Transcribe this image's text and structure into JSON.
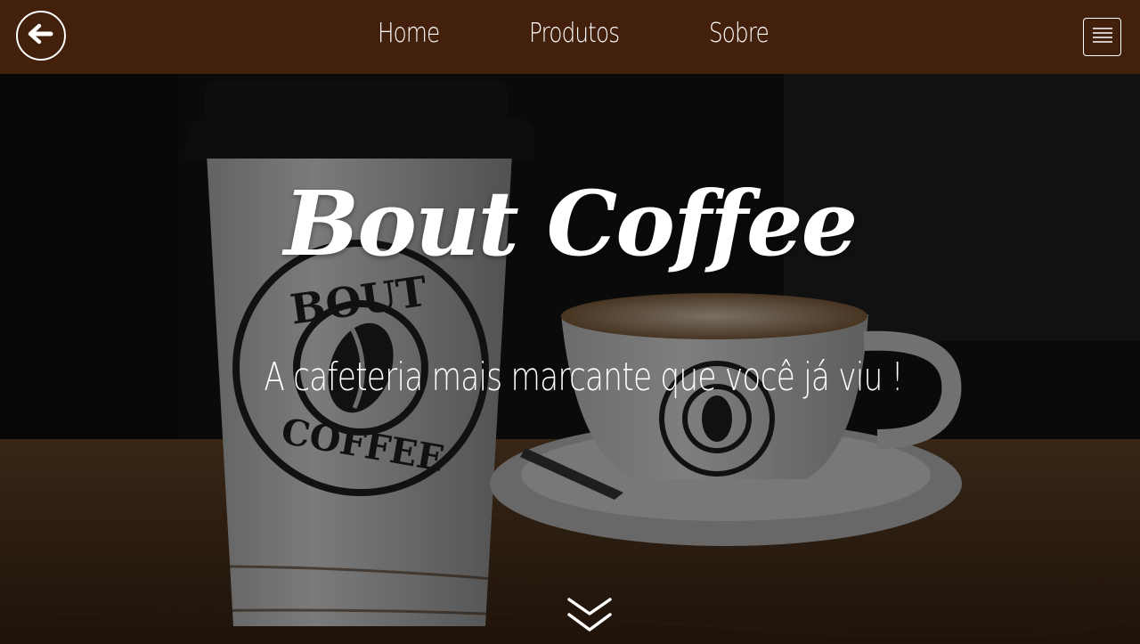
{
  "navbar": {
    "background_color": "#43200c",
    "back_icon": "arrow-left-icon",
    "links": [
      {
        "label": "Home"
      },
      {
        "label": "Produtos"
      },
      {
        "label": "Sobre"
      }
    ],
    "menu_icon": "hamburger-menu-icon"
  },
  "hero": {
    "title": "Bout Coffee",
    "subtitle": "A cafeteria mais marcante que você já viu !",
    "scroll_icon": "double-chevron-down-icon",
    "image": {
      "cup_logo_text_top": "BOUT",
      "cup_logo_text_bottom": "COFFEE"
    }
  }
}
